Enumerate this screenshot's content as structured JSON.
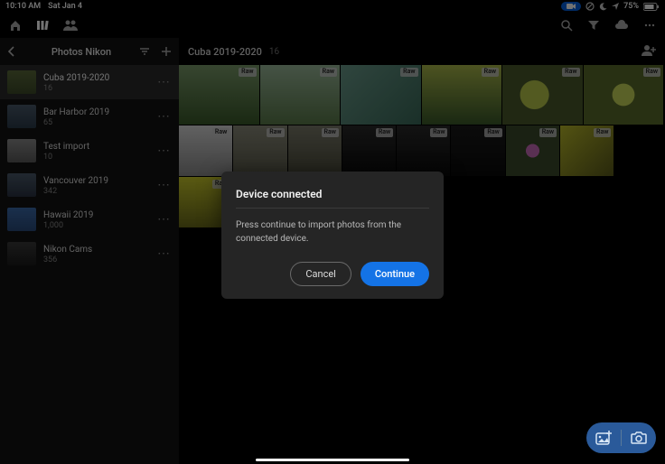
{
  "statusbar": {
    "time": "10:10 AM",
    "date": "Sat Jan 4",
    "battery_pct": "75%"
  },
  "toolbar": {
    "icons": [
      "home",
      "library",
      "people"
    ],
    "right_icons": [
      "search",
      "filter",
      "cloud",
      "more"
    ]
  },
  "sidebar": {
    "title": "Photos Nikon",
    "albums": [
      {
        "name": "Cuba 2019-2020",
        "count": "16",
        "selected": true,
        "thumb": [
          "#5b6a3a",
          "#3c4a28"
        ]
      },
      {
        "name": "Bar Harbor 2019",
        "count": "65",
        "selected": false,
        "thumb": [
          "#4a5a6a",
          "#2a3a4a"
        ]
      },
      {
        "name": "Test import",
        "count": "10",
        "selected": false,
        "thumb": [
          "#8a8a8a",
          "#5a5a5a"
        ]
      },
      {
        "name": "Vancouver 2019",
        "count": "342",
        "selected": false,
        "thumb": [
          "#4a5a6a",
          "#2a3242"
        ]
      },
      {
        "name": "Hawaii 2019",
        "count": "1,000",
        "selected": false,
        "thumb": [
          "#3a6aaa",
          "#2a4a7a"
        ]
      },
      {
        "name": "Nikon Cams",
        "count": "356",
        "selected": false,
        "thumb": [
          "#3a3a3a",
          "#1a1a1a"
        ]
      }
    ]
  },
  "content": {
    "title": "Cuba 2019-2020",
    "count": "16",
    "raw_badge": "Raw",
    "thumbs": [
      {
        "bg": "linear-gradient(180deg,#7a9a6a,#3a5a2a)"
      },
      {
        "bg": "linear-gradient(180deg,#9ab89a,#5a7a4a)"
      },
      {
        "bg": "linear-gradient(135deg,#6a9a8a,#3a6a5a)"
      },
      {
        "bg": "linear-gradient(180deg,#aab84a,#3a5a2a)"
      },
      {
        "bg": "radial-gradient(circle at 40% 50%,#b8c84a 25%,#4a5a2a 26%)"
      },
      {
        "bg": "radial-gradient(circle at 50% 50%,#c8d85a 22%,#5a6a2a 23%)"
      },
      {
        "bg": "linear-gradient(180deg,#d8d8d8,#8a8a8a)"
      },
      {
        "bg": "linear-gradient(180deg,#8a8a7a,#5a5a4a)"
      },
      {
        "bg": "linear-gradient(180deg,#7a7a6a,#4a4a3a)"
      },
      {
        "bg": "linear-gradient(180deg,#2a2a2a,#0a0a0a)"
      },
      {
        "bg": "linear-gradient(180deg,#2a2a2a,#0a0a0a)"
      },
      {
        "bg": "linear-gradient(180deg,#1a1a1a,#0a0a0a)"
      },
      {
        "bg": "radial-gradient(circle at 50% 50%,#c86ab8 18%,#3a4a2a 19%)"
      },
      {
        "bg": "linear-gradient(135deg,#b8b82a,#5a5a1a)"
      },
      {
        "bg": "linear-gradient(180deg,#c8c82a,#6a6a1a)"
      },
      {
        "bg": "linear-gradient(180deg,#b8b85a,#6a6a2a)"
      }
    ]
  },
  "dialog": {
    "title": "Device connected",
    "body": "Press continue to import photos from the connected device.",
    "cancel": "Cancel",
    "continue": "Continue"
  }
}
